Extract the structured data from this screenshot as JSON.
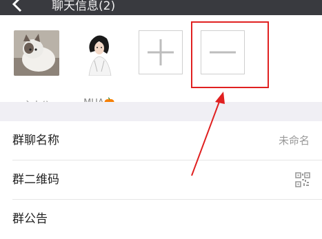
{
  "topbar": {
    "title": "聊天信息(2)"
  },
  "members": [
    {
      "name": "主人公"
    },
    {
      "name": "MUA🎃"
    }
  ],
  "actions": {
    "add_symbol": "+",
    "remove_symbol": "−"
  },
  "settings": {
    "group_name": {
      "label": "群聊名称",
      "value": "未命名"
    },
    "qr_code": {
      "label": "群二维码"
    },
    "announcement": {
      "label": "群公告"
    }
  },
  "colors": {
    "topbar": "#393a3f",
    "highlight": "#e02020",
    "arrow": "#e02020"
  }
}
